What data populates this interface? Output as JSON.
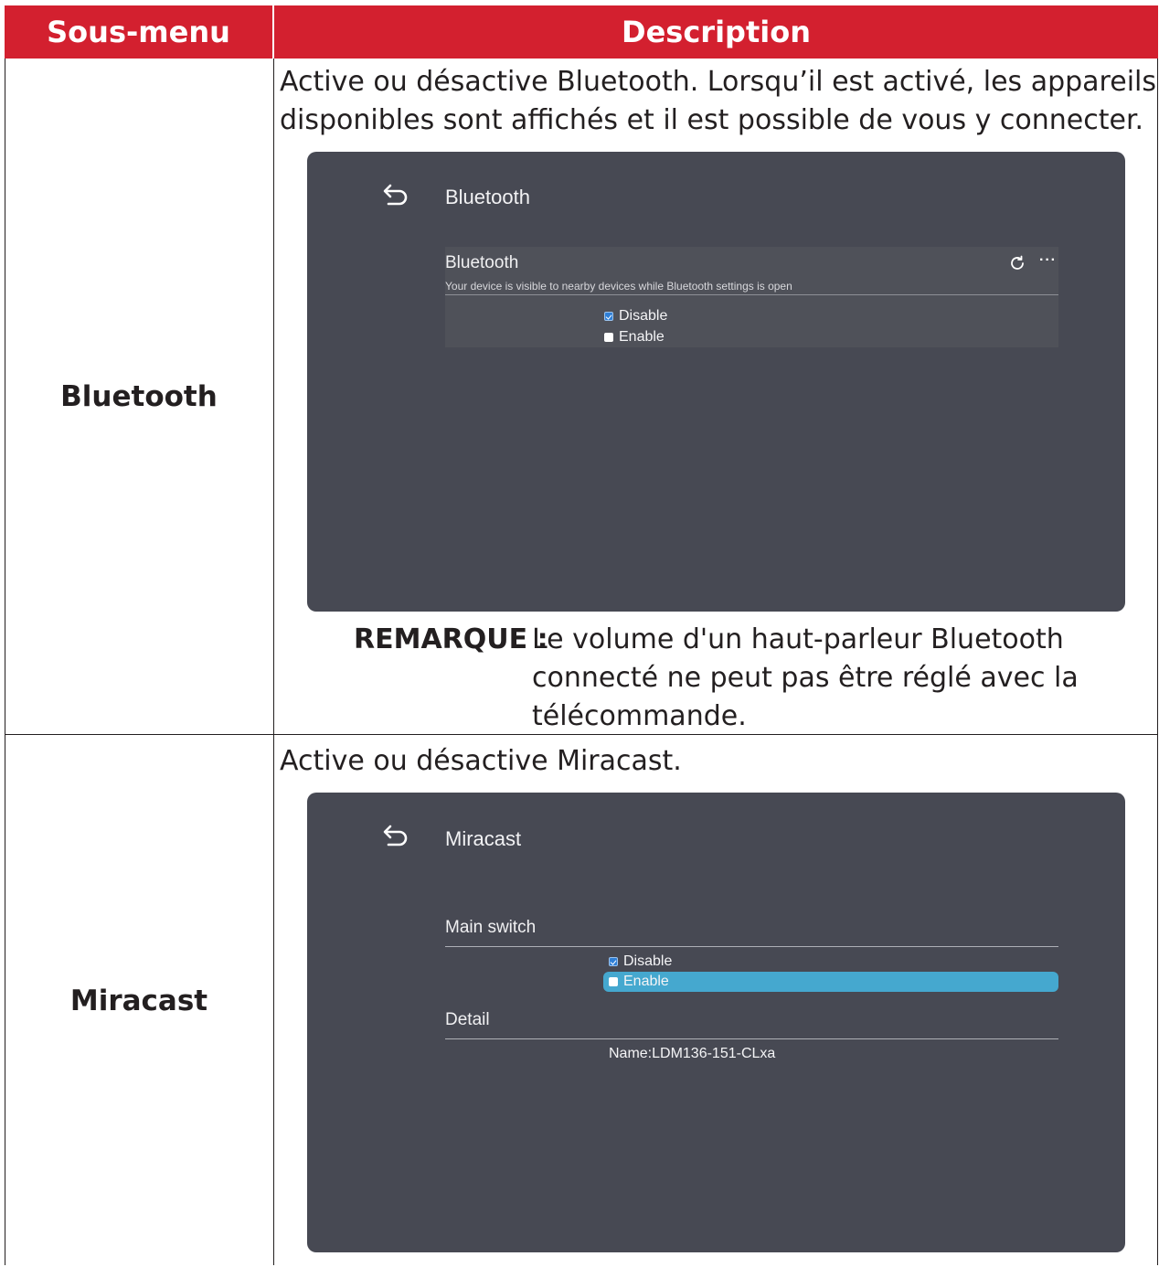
{
  "table": {
    "headers": [
      "Sous-menu",
      "Description"
    ]
  },
  "rows": [
    {
      "label": "Bluetooth",
      "description": [
        "Active ou désactive Bluetooth. Lorsqu’il est activé, les appareils",
        "disponibles sont affichés et il est possible de vous y connecter."
      ],
      "screen": {
        "title": "Bluetooth",
        "section_title": "Bluetooth",
        "section_subtitle": "Your device is visible to nearby devices while Bluetooth settings is open",
        "options": [
          {
            "label": "Disable",
            "checked": true
          },
          {
            "label": "Enable",
            "checked": false
          }
        ],
        "icons": [
          "back-arrow-icon",
          "refresh-icon",
          "more-icon"
        ],
        "more_label": "···"
      },
      "note": {
        "label": "REMARQUE :",
        "lines": [
          "Le volume d'un haut-parleur Bluetooth",
          "connecté ne peut pas être réglé avec la",
          "télécommande."
        ]
      }
    },
    {
      "label": "Miracast",
      "description": [
        "Active ou désactive Miracast."
      ],
      "screen": {
        "title": "Miracast",
        "main_switch_label": "Main switch",
        "options": [
          {
            "label": "Disable",
            "checked": true
          },
          {
            "label": "Enable",
            "checked": false,
            "highlighted": true
          }
        ],
        "detail_label": "Detail",
        "device_name": "Name:LDM136-151-CLxa",
        "icons": [
          "back-arrow-icon"
        ]
      }
    }
  ],
  "colors": {
    "header_bg": "#d3202f",
    "screen_bg": "#474953",
    "highlight": "#45a8cf"
  }
}
